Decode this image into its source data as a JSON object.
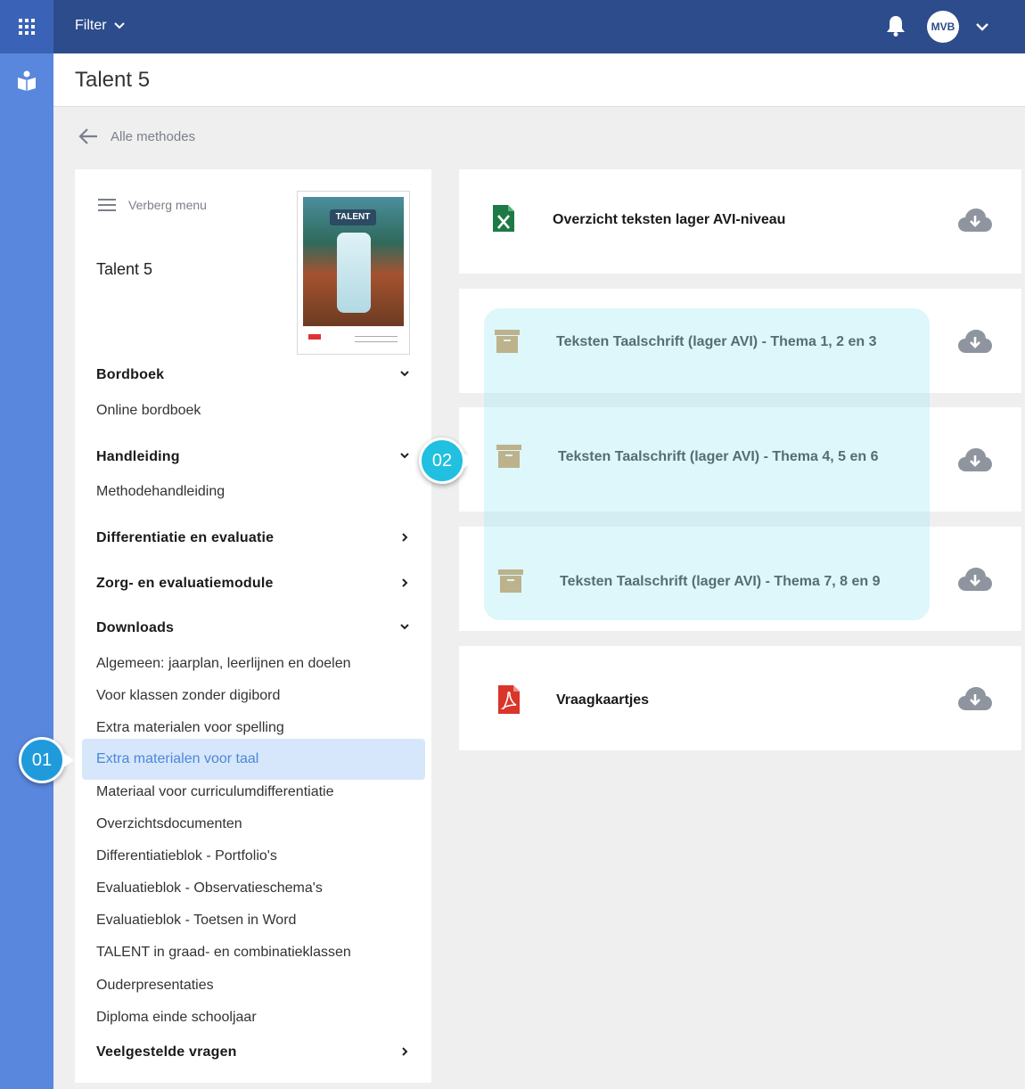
{
  "topbar": {
    "filter_label": "Filter",
    "avatar_initials": "MVB"
  },
  "page_title": "Talent 5",
  "back_label": "Alle methodes",
  "sidebar": {
    "hide_menu_label": "Verberg menu",
    "title": "Talent 5",
    "cover": {
      "logo_text": "TALENT"
    },
    "sections": {
      "bordboek": {
        "label": "Bordboek",
        "items": [
          "Online bordboek"
        ]
      },
      "handleiding": {
        "label": "Handleiding",
        "items": [
          "Methodehandleiding"
        ]
      },
      "differentiatie": {
        "label": "Differentiatie en evaluatie"
      },
      "zorg": {
        "label": "Zorg- en evaluatiemodule"
      },
      "downloads": {
        "label": "Downloads",
        "items": [
          "Algemeen: jaarplan, leerlijnen en doelen",
          "Voor klassen zonder digibord",
          "Extra materialen voor spelling",
          "Extra materialen voor taal",
          "Materiaal voor curriculumdifferentiatie",
          "Overzichtsdocumenten",
          "Differentiatieblok - Portfolio's",
          "Evaluatieblok - Observatieschema's",
          "Evaluatieblok - Toetsen in Word",
          "TALENT in graad- en combinatieklassen",
          "Ouderpresentaties",
          "Diploma einde schooljaar"
        ]
      },
      "faq": {
        "label": "Veelgestelde vragen"
      }
    }
  },
  "files": [
    {
      "title": "Overzicht teksten lager AVI-niveau",
      "icon": "excel-file-icon"
    },
    {
      "title": "Teksten Taalschrift (lager AVI) - Thema 1, 2 en 3",
      "icon": "archive-box-icon"
    },
    {
      "title": "Teksten Taalschrift (lager AVI) - Thema 4, 5 en 6",
      "icon": "archive-box-icon"
    },
    {
      "title": "Teksten Taalschrift (lager AVI) - Thema 7, 8 en 9",
      "icon": "archive-box-icon"
    },
    {
      "title": "Vraagkaartjes",
      "icon": "pdf-file-icon"
    }
  ],
  "callouts": {
    "one": "01",
    "two": "02"
  },
  "colors": {
    "topbar": "#2c4c8c",
    "rail": "#5a87de",
    "active_item_bg": "#d6e7fb",
    "active_item_text": "#4e86d8",
    "callout": "#1f9bdc"
  }
}
